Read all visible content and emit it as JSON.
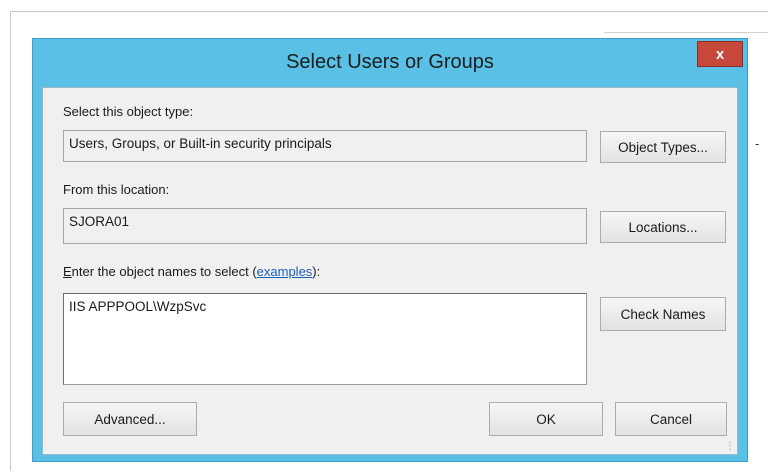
{
  "dialog": {
    "title": "Select Users or Groups",
    "close_label": "x"
  },
  "object_type": {
    "label": "Select this object type:",
    "value": "Users, Groups, or Built-in security principals",
    "button": "Object Types..."
  },
  "location": {
    "label": "From this location:",
    "value": "SJORA01",
    "button": "Locations..."
  },
  "names": {
    "label_first_letter": "E",
    "label_rest": "nter the object names to select (",
    "link": "examples",
    "label_end": "):",
    "value": "IIS APPPOOL\\WzpSvc",
    "button": "Check Names"
  },
  "buttons": {
    "advanced": "Advanced...",
    "ok": "OK",
    "cancel": "Cancel"
  }
}
